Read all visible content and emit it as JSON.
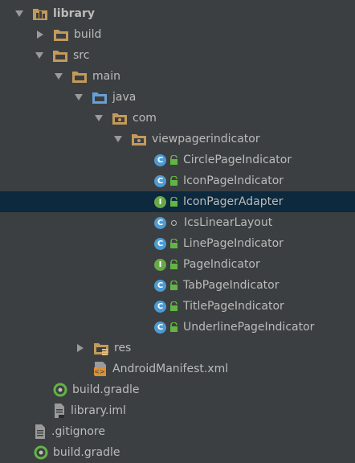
{
  "tree": {
    "library": "library",
    "build": "build",
    "src": "src",
    "main": "main",
    "java": "java",
    "com": "com",
    "viewpagerindicator": "viewpagerindicator",
    "classes": [
      {
        "name": "CirclePageIndicator",
        "kind": "class"
      },
      {
        "name": "IconPageIndicator",
        "kind": "class"
      },
      {
        "name": "IconPagerAdapter",
        "kind": "interface"
      },
      {
        "name": "IcsLinearLayout",
        "kind": "class"
      },
      {
        "name": "LinePageIndicator",
        "kind": "class"
      },
      {
        "name": "PageIndicator",
        "kind": "interface"
      },
      {
        "name": "TabPageIndicator",
        "kind": "class"
      },
      {
        "name": "TitlePageIndicator",
        "kind": "class"
      },
      {
        "name": "UnderlinePageIndicator",
        "kind": "class"
      }
    ],
    "class_badge": "C",
    "interface_badge": "I",
    "res": "res",
    "manifest": "AndroidManifest.xml",
    "library_build_gradle": "build.gradle",
    "library_iml": "library.iml",
    "gitignore": ".gitignore",
    "root_build_gradle": "build.gradle"
  },
  "colors": {
    "background": "#3c3f41",
    "selection": "#0d293e",
    "folder": "#c49a5b",
    "source_folder": "#6a9fd4",
    "class_badge": "#4d9bd3",
    "interface_badge": "#69a84a",
    "lock": "#62b543"
  }
}
